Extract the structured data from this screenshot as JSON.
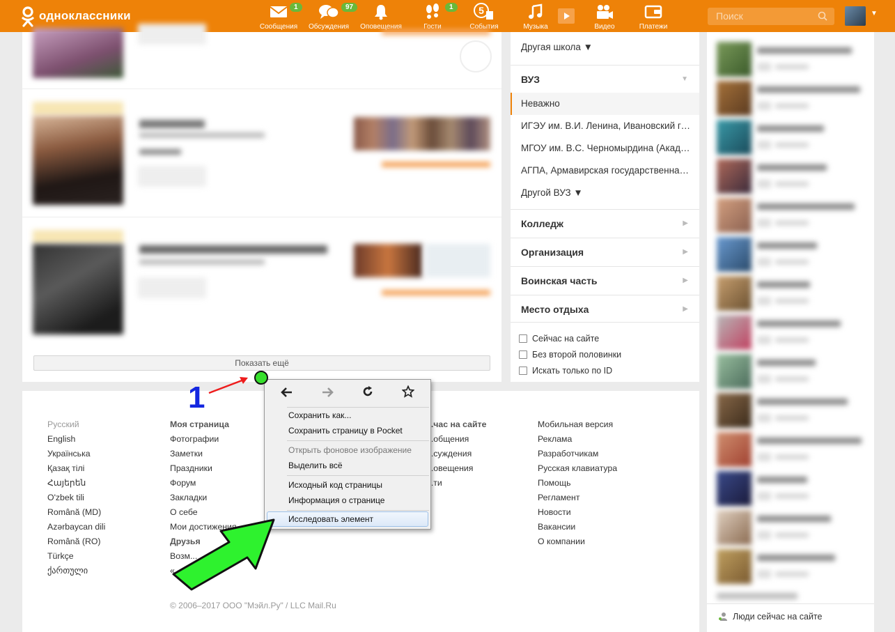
{
  "topbar": {
    "logo_text": "одноклассники",
    "nav": [
      {
        "label": "Сообщения",
        "badge": "1",
        "icon": "envelope-icon",
        "glyph": "✉"
      },
      {
        "label": "Обсуждения",
        "badge": "97",
        "icon": "chat-bubbles-icon",
        "glyph": "💬"
      },
      {
        "label": "Оповещения",
        "badge": "",
        "icon": "bell-icon",
        "glyph": "🔔"
      },
      {
        "label": "Гости",
        "badge": "1",
        "icon": "footprints-icon",
        "glyph": "👣"
      },
      {
        "label": "События",
        "badge": "",
        "icon": "events-five-icon",
        "glyph": "5"
      },
      {
        "label": "Музыка",
        "badge": "",
        "icon": "music-note-icon",
        "glyph": "♫"
      },
      {
        "label": "Видео",
        "badge": "",
        "icon": "video-camera-icon",
        "glyph": "🎥"
      },
      {
        "label": "Платежи",
        "badge": "",
        "icon": "wallet-icon",
        "glyph": "▣"
      }
    ],
    "search_placeholder": "Поиск",
    "colors": {
      "brand": "#ee8208",
      "badge": "#6ab83a"
    }
  },
  "main": {
    "show_more_label": "Показать ещё"
  },
  "filter": {
    "other_school": "Другая школа ▼",
    "vuz_heading": "ВУЗ",
    "vuz_options": [
      "Неважно",
      "ИГЭУ им. В.И. Ленина, Ивановский государственный энергетический университет",
      "МГОУ им. В.С. Черномырдина (Академия)",
      "АГПА, Армавирская государственная педагогическая академия"
    ],
    "other_vuz": "Другой ВУЗ ▼",
    "sections": [
      "Колледж",
      "Организация",
      "Воинская часть",
      "Место отдыха"
    ],
    "checkboxes": [
      "Сейчас на сайте",
      "Без второй половинки",
      "Искать только по ID"
    ]
  },
  "friends": {
    "people_now_label": "Люди сейчас на сайте"
  },
  "footer": {
    "languages_current": "Русский",
    "languages": [
      "English",
      "Українська",
      "Қазақ тілі",
      "Հայերեն",
      "O'zbek tili",
      "Română (MD)",
      "Azərbaycan dili",
      "Română (RO)",
      "Türkçe",
      "ქართული"
    ],
    "my_page_heading": "Моя страница",
    "my_page_links": [
      "Фотографии",
      "Заметки",
      "Праздники",
      "Форум",
      "Закладки",
      "О себе",
      "Мои достижения"
    ],
    "friends_heading": "Друзья",
    "friends_links": [
      "Возм...          ...мы",
      "«...            ...исок»"
    ],
    "now_heading": "...час на сайте",
    "now_links": [
      "...общения",
      "...суждения",
      "...овещения",
      "...ти"
    ],
    "service_links": [
      "Мобильная версия",
      "Реклама",
      "Разработчикам",
      "Русская клавиатура",
      "Помощь",
      "Регламент",
      "Новости",
      "Вакансии",
      "О компании"
    ],
    "copyright": "© 2006–2017 ООО \"Мэйл.Ру\" / LLC Mail.Ru"
  },
  "context_menu": {
    "nav": [
      "back-arrow-icon",
      "forward-arrow-icon",
      "reload-icon",
      "bookmark-star-icon"
    ],
    "items": [
      {
        "label": "Сохранить как...",
        "disabled": false
      },
      {
        "label": "Сохранить страницу в Pocket",
        "disabled": false
      },
      {
        "label": "Открыть фоновое изображение",
        "disabled": true
      },
      {
        "label": "Выделить всё",
        "disabled": false
      },
      {
        "label": "Исходный код страницы",
        "disabled": false
      },
      {
        "label": "Информация о странице",
        "disabled": false
      },
      {
        "label": "Исследовать элемент",
        "disabled": false,
        "highlighted": true
      }
    ]
  },
  "annotation": {
    "step_number": "1"
  }
}
